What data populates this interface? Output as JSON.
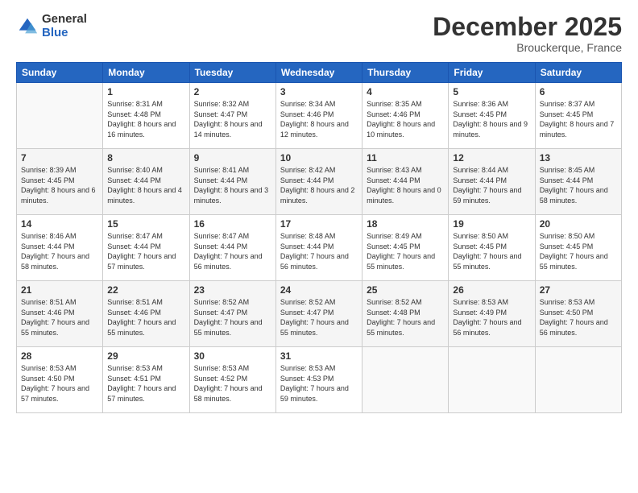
{
  "logo": {
    "general": "General",
    "blue": "Blue"
  },
  "header": {
    "title": "December 2025",
    "subtitle": "Brouckerque, France"
  },
  "weekdays": [
    "Sunday",
    "Monday",
    "Tuesday",
    "Wednesday",
    "Thursday",
    "Friday",
    "Saturday"
  ],
  "weeks": [
    [
      {
        "day": "",
        "sunrise": "",
        "sunset": "",
        "daylight": ""
      },
      {
        "day": "1",
        "sunrise": "Sunrise: 8:31 AM",
        "sunset": "Sunset: 4:48 PM",
        "daylight": "Daylight: 8 hours and 16 minutes."
      },
      {
        "day": "2",
        "sunrise": "Sunrise: 8:32 AM",
        "sunset": "Sunset: 4:47 PM",
        "daylight": "Daylight: 8 hours and 14 minutes."
      },
      {
        "day": "3",
        "sunrise": "Sunrise: 8:34 AM",
        "sunset": "Sunset: 4:46 PM",
        "daylight": "Daylight: 8 hours and 12 minutes."
      },
      {
        "day": "4",
        "sunrise": "Sunrise: 8:35 AM",
        "sunset": "Sunset: 4:46 PM",
        "daylight": "Daylight: 8 hours and 10 minutes."
      },
      {
        "day": "5",
        "sunrise": "Sunrise: 8:36 AM",
        "sunset": "Sunset: 4:45 PM",
        "daylight": "Daylight: 8 hours and 9 minutes."
      },
      {
        "day": "6",
        "sunrise": "Sunrise: 8:37 AM",
        "sunset": "Sunset: 4:45 PM",
        "daylight": "Daylight: 8 hours and 7 minutes."
      }
    ],
    [
      {
        "day": "7",
        "sunrise": "Sunrise: 8:39 AM",
        "sunset": "Sunset: 4:45 PM",
        "daylight": "Daylight: 8 hours and 6 minutes."
      },
      {
        "day": "8",
        "sunrise": "Sunrise: 8:40 AM",
        "sunset": "Sunset: 4:44 PM",
        "daylight": "Daylight: 8 hours and 4 minutes."
      },
      {
        "day": "9",
        "sunrise": "Sunrise: 8:41 AM",
        "sunset": "Sunset: 4:44 PM",
        "daylight": "Daylight: 8 hours and 3 minutes."
      },
      {
        "day": "10",
        "sunrise": "Sunrise: 8:42 AM",
        "sunset": "Sunset: 4:44 PM",
        "daylight": "Daylight: 8 hours and 2 minutes."
      },
      {
        "day": "11",
        "sunrise": "Sunrise: 8:43 AM",
        "sunset": "Sunset: 4:44 PM",
        "daylight": "Daylight: 8 hours and 0 minutes."
      },
      {
        "day": "12",
        "sunrise": "Sunrise: 8:44 AM",
        "sunset": "Sunset: 4:44 PM",
        "daylight": "Daylight: 7 hours and 59 minutes."
      },
      {
        "day": "13",
        "sunrise": "Sunrise: 8:45 AM",
        "sunset": "Sunset: 4:44 PM",
        "daylight": "Daylight: 7 hours and 58 minutes."
      }
    ],
    [
      {
        "day": "14",
        "sunrise": "Sunrise: 8:46 AM",
        "sunset": "Sunset: 4:44 PM",
        "daylight": "Daylight: 7 hours and 58 minutes."
      },
      {
        "day": "15",
        "sunrise": "Sunrise: 8:47 AM",
        "sunset": "Sunset: 4:44 PM",
        "daylight": "Daylight: 7 hours and 57 minutes."
      },
      {
        "day": "16",
        "sunrise": "Sunrise: 8:47 AM",
        "sunset": "Sunset: 4:44 PM",
        "daylight": "Daylight: 7 hours and 56 minutes."
      },
      {
        "day": "17",
        "sunrise": "Sunrise: 8:48 AM",
        "sunset": "Sunset: 4:44 PM",
        "daylight": "Daylight: 7 hours and 56 minutes."
      },
      {
        "day": "18",
        "sunrise": "Sunrise: 8:49 AM",
        "sunset": "Sunset: 4:45 PM",
        "daylight": "Daylight: 7 hours and 55 minutes."
      },
      {
        "day": "19",
        "sunrise": "Sunrise: 8:50 AM",
        "sunset": "Sunset: 4:45 PM",
        "daylight": "Daylight: 7 hours and 55 minutes."
      },
      {
        "day": "20",
        "sunrise": "Sunrise: 8:50 AM",
        "sunset": "Sunset: 4:45 PM",
        "daylight": "Daylight: 7 hours and 55 minutes."
      }
    ],
    [
      {
        "day": "21",
        "sunrise": "Sunrise: 8:51 AM",
        "sunset": "Sunset: 4:46 PM",
        "daylight": "Daylight: 7 hours and 55 minutes."
      },
      {
        "day": "22",
        "sunrise": "Sunrise: 8:51 AM",
        "sunset": "Sunset: 4:46 PM",
        "daylight": "Daylight: 7 hours and 55 minutes."
      },
      {
        "day": "23",
        "sunrise": "Sunrise: 8:52 AM",
        "sunset": "Sunset: 4:47 PM",
        "daylight": "Daylight: 7 hours and 55 minutes."
      },
      {
        "day": "24",
        "sunrise": "Sunrise: 8:52 AM",
        "sunset": "Sunset: 4:47 PM",
        "daylight": "Daylight: 7 hours and 55 minutes."
      },
      {
        "day": "25",
        "sunrise": "Sunrise: 8:52 AM",
        "sunset": "Sunset: 4:48 PM",
        "daylight": "Daylight: 7 hours and 55 minutes."
      },
      {
        "day": "26",
        "sunrise": "Sunrise: 8:53 AM",
        "sunset": "Sunset: 4:49 PM",
        "daylight": "Daylight: 7 hours and 56 minutes."
      },
      {
        "day": "27",
        "sunrise": "Sunrise: 8:53 AM",
        "sunset": "Sunset: 4:50 PM",
        "daylight": "Daylight: 7 hours and 56 minutes."
      }
    ],
    [
      {
        "day": "28",
        "sunrise": "Sunrise: 8:53 AM",
        "sunset": "Sunset: 4:50 PM",
        "daylight": "Daylight: 7 hours and 57 minutes."
      },
      {
        "day": "29",
        "sunrise": "Sunrise: 8:53 AM",
        "sunset": "Sunset: 4:51 PM",
        "daylight": "Daylight: 7 hours and 57 minutes."
      },
      {
        "day": "30",
        "sunrise": "Sunrise: 8:53 AM",
        "sunset": "Sunset: 4:52 PM",
        "daylight": "Daylight: 7 hours and 58 minutes."
      },
      {
        "day": "31",
        "sunrise": "Sunrise: 8:53 AM",
        "sunset": "Sunset: 4:53 PM",
        "daylight": "Daylight: 7 hours and 59 minutes."
      },
      {
        "day": "",
        "sunrise": "",
        "sunset": "",
        "daylight": ""
      },
      {
        "day": "",
        "sunrise": "",
        "sunset": "",
        "daylight": ""
      },
      {
        "day": "",
        "sunrise": "",
        "sunset": "",
        "daylight": ""
      }
    ]
  ]
}
